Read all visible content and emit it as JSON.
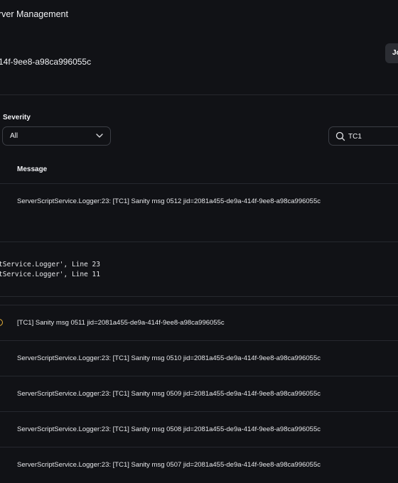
{
  "header": {
    "title": "rver Management",
    "job_id": "14f-9ee8-a98ca996055c",
    "join_button": "Jo"
  },
  "filters": {
    "severity_label": "Severity",
    "severity_value": "All",
    "search_value": "TC1"
  },
  "table": {
    "column_message": "Message",
    "rows": [
      {
        "message": "ServerScriptService.Logger:23: [TC1] Sanity msg 0512 jid=2081a455-de9a-414f-9ee8-a98ca996055c"
      },
      {
        "message": "[TC1] Sanity msg 0511 jid=2081a455-de9a-414f-9ee8-a98ca996055c"
      },
      {
        "message": "ServerScriptService.Logger:23: [TC1] Sanity msg 0510 jid=2081a455-de9a-414f-9ee8-a98ca996055c"
      },
      {
        "message": "ServerScriptService.Logger:23: [TC1] Sanity msg 0509 jid=2081a455-de9a-414f-9ee8-a98ca996055c"
      },
      {
        "message": "ServerScriptService.Logger:23: [TC1] Sanity msg 0508 jid=2081a455-de9a-414f-9ee8-a98ca996055c"
      },
      {
        "message": "ServerScriptService.Logger:23: [TC1] Sanity msg 0507 jid=2081a455-de9a-414f-9ee8-a98ca996055c"
      }
    ],
    "stack_trace": [
      "tService.Logger', Line 23",
      "tService.Logger', Line 11"
    ]
  },
  "colors": {
    "background": "#111216",
    "warning": "#e8b23a"
  }
}
